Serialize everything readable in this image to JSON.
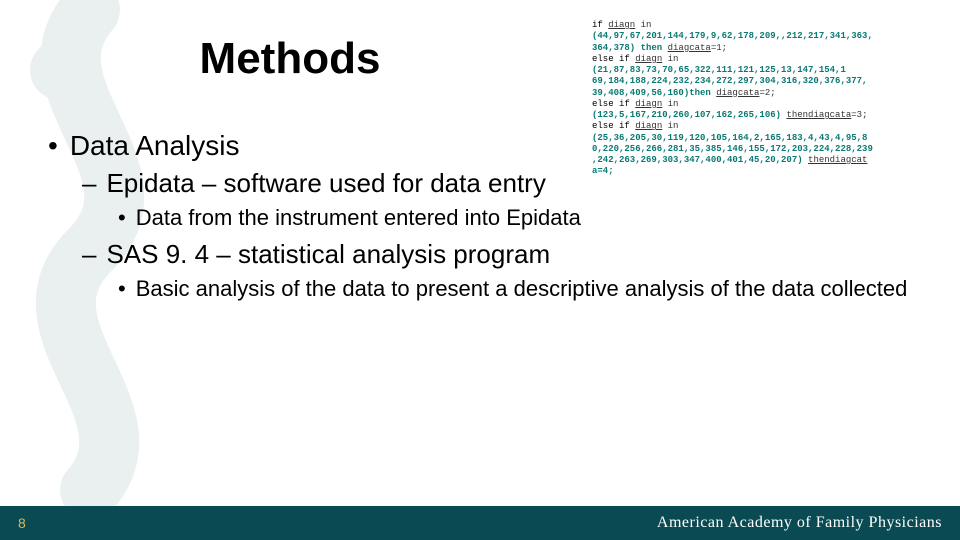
{
  "title": "Methods",
  "bullets": {
    "l1": "Data Analysis",
    "l2a": "Epidata – software used for data entry",
    "l3a": "Data from the instrument entered into Epidata",
    "l2b": "SAS  9. 4 – statistical analysis program",
    "l3b": "Basic analysis of the data to present a descriptive analysis of the data collected"
  },
  "code": {
    "l1a": "if ",
    "l1b": "diagn",
    " l1c": " in",
    "l2": "(44,97,67,201,144,179,9,62,178,209,,212,217,341,363,",
    "l3a": "364,378) then ",
    "l3b": "diagcata",
    "l3c": "=1;",
    "l4a": "else if ",
    "l4b": "diagn",
    "l4c": " in",
    "l5": "(21,87,83,73,70,65,322,111,121,125,13,147,154,1",
    "l6": "69,184,188,224,232,234,272,297,304,316,320,376,377,",
    "l7a": "39,408,409,56,160)then ",
    "l7b": "diagcata",
    "l7c": "=2;",
    "l8a": "else if ",
    "l8b": "diagn",
    "l8c": " in",
    "l9a": "(123,5,167,210,260,107,162,265,106) ",
    "l9b": "then",
    "l9c": "diagcata",
    "l9d": "=3;",
    "l10a": "else if ",
    "l10b": "diagn",
    "l10c": " in",
    "l11": "(25,36,205,30,119,120,105,164,2,165,183,4,43,4,95,8",
    "l12": "0,220,256,266,281,35,385,146,155,172,203,224,228,239",
    "l13a": ",242,263,269,303,347,400,401,45,20,207) ",
    "l13b": "then",
    "l13c": "diagcat",
    "l14": "a=4;"
  },
  "footer": {
    "slidenum": "8",
    "brand": "American Academy of Family Physicians"
  }
}
